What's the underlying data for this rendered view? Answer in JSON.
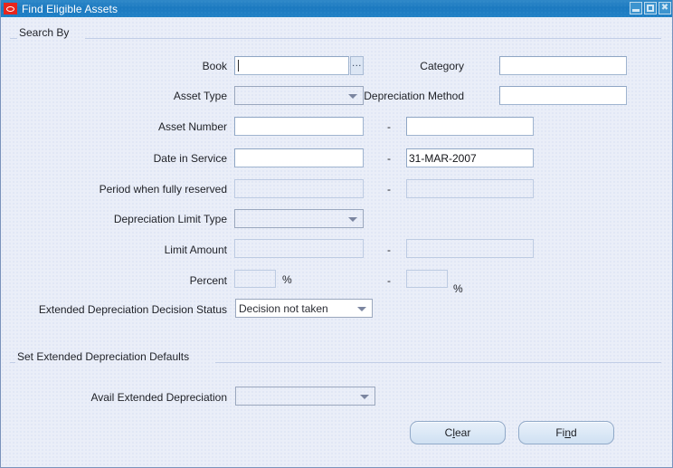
{
  "window": {
    "title": "Find Eligible Assets",
    "logo_icon": "oracle-logo-icon",
    "controls": [
      {
        "name": "minimize-button",
        "icon": "minimize-icon",
        "label": "_"
      },
      {
        "name": "maximize-button",
        "icon": "maximize-icon",
        "label": "□"
      },
      {
        "name": "close-button",
        "icon": "close-icon",
        "label": "✖"
      }
    ]
  },
  "groups": {
    "search_by": "Search By",
    "set_defaults": "Set Extended Depreciation Defaults"
  },
  "fields": {
    "book": {
      "label": "Book",
      "value": "",
      "lov_label": "...",
      "state": "enabled-focused"
    },
    "category": {
      "label": "Category",
      "value": "",
      "state": "enabled"
    },
    "asset_type": {
      "label": "Asset Type",
      "value": "",
      "state": "disabled",
      "arrow_icon": "chevron-down-icon"
    },
    "depreciation_method": {
      "label": "Depreciation Method",
      "value": "",
      "state": "enabled"
    },
    "asset_number": {
      "label": "Asset Number",
      "from_value": "",
      "to_value": "",
      "separator": "-",
      "state": "enabled"
    },
    "date_in_service": {
      "label": "Date in Service",
      "from_value": "",
      "to_value": "31-MAR-2007",
      "separator": "-",
      "state": "enabled"
    },
    "period_fully_reserved": {
      "label": "Period when fully reserved",
      "from_value": "",
      "to_value": "",
      "separator": "-",
      "state": "disabled"
    },
    "depreciation_limit_type": {
      "label": "Depreciation Limit Type",
      "value": "",
      "state": "disabled",
      "arrow_icon": "chevron-down-icon"
    },
    "limit_amount": {
      "label": "Limit Amount",
      "from_value": "",
      "to_value": "",
      "separator": "-",
      "state": "disabled"
    },
    "percent": {
      "label": "Percent",
      "from_value": "",
      "to_value": "",
      "separator": "-",
      "unit": "%",
      "state": "disabled"
    },
    "extended_decision_status": {
      "label": "Extended Depreciation Decision Status",
      "value": "Decision not taken",
      "state": "enabled",
      "arrow_icon": "chevron-down-icon"
    },
    "avail_extended_depreciation": {
      "label": "Avail Extended Depreciation",
      "value": "",
      "state": "disabled",
      "arrow_icon": "chevron-down-icon"
    }
  },
  "buttons": {
    "clear": {
      "pre": "C",
      "mnemonic": "l",
      "post": "ear"
    },
    "find": {
      "pre": "Fi",
      "mnemonic": "n",
      "post": "d"
    }
  }
}
